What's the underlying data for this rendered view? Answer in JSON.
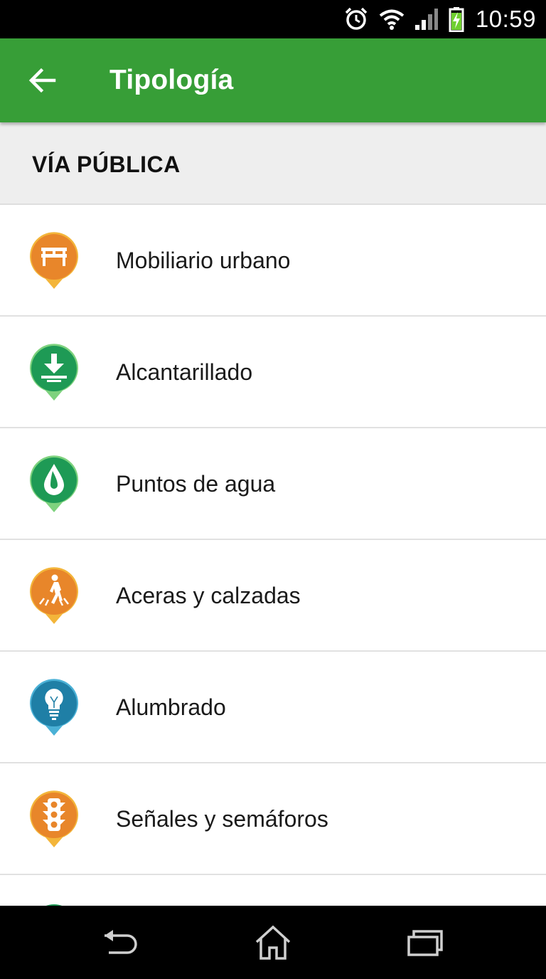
{
  "status_bar": {
    "time": "10:59"
  },
  "app_bar": {
    "title": "Tipología",
    "back_icon": "arrow-back-icon"
  },
  "section": {
    "title": "VÍA PÚBLICA"
  },
  "colors": {
    "app_bar": "#379e37",
    "orange": "#e8862a",
    "green": "#1e9a55",
    "blue": "#1f7fa6"
  },
  "items": [
    {
      "label": "Mobiliario urbano",
      "icon": "bench-icon",
      "color": "orange"
    },
    {
      "label": "Alcantarillado",
      "icon": "drain-icon",
      "color": "green"
    },
    {
      "label": "Puntos de agua",
      "icon": "water-drop-icon",
      "color": "green"
    },
    {
      "label": "Aceras y calzadas",
      "icon": "pedestrian-icon",
      "color": "orange"
    },
    {
      "label": "Alumbrado",
      "icon": "lightbulb-icon",
      "color": "blue"
    },
    {
      "label": "Señales y semáforos",
      "icon": "traffic-light-icon",
      "color": "orange"
    }
  ]
}
